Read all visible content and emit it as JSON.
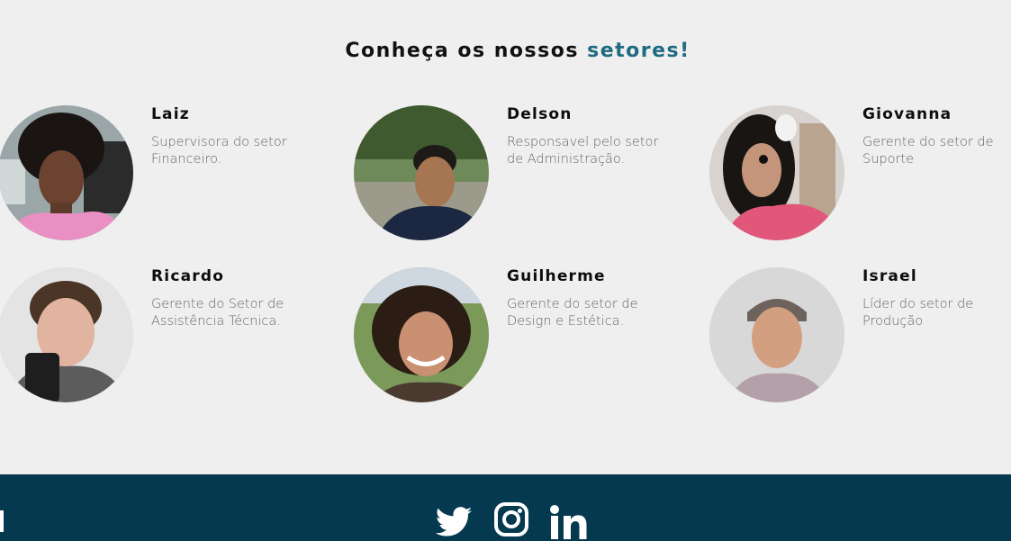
{
  "section": {
    "heading_main": "Conheça os nossos",
    "heading_accent": "setores!"
  },
  "members": [
    {
      "name": "Laiz",
      "role": "Supervisora do setor Financeiro."
    },
    {
      "name": "Delson",
      "role": "Responsavel pelo setor de Administração."
    },
    {
      "name": "Giovanna",
      "role": "Gerente do setor de Suporte"
    },
    {
      "name": "Ricardo",
      "role": "Gerente do Setor de Assistência Técnica."
    },
    {
      "name": "Guilherme",
      "role": "Gerente do setor de Design e Estética."
    },
    {
      "name": "Israel",
      "role": "Líder do setor de Produção"
    }
  ],
  "footer": {
    "icons": [
      "twitter-icon",
      "instagram-icon",
      "linkedin-icon"
    ]
  },
  "colors": {
    "background": "#efefef",
    "accent": "#1f6b82",
    "footer": "#04394f"
  }
}
